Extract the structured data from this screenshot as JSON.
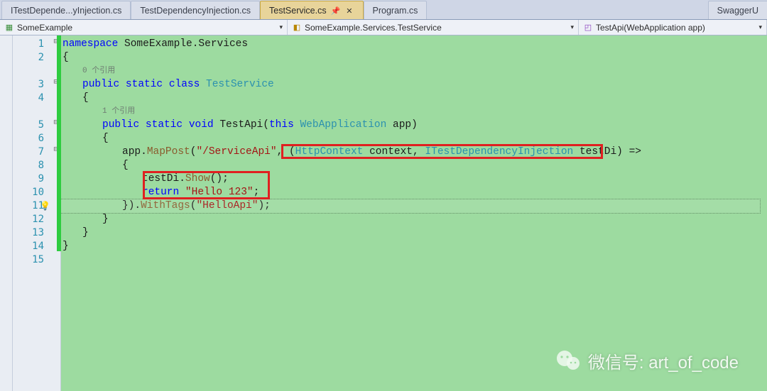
{
  "tabs": [
    {
      "label": "ITestDepende...yInjection.cs",
      "active": false
    },
    {
      "label": "TestDependencyInjection.cs",
      "active": false
    },
    {
      "label": "TestService.cs",
      "active": true,
      "pinned": true
    },
    {
      "label": "Program.cs",
      "active": false
    }
  ],
  "tab_right": {
    "label": "SwaggerU"
  },
  "nav": {
    "project": "SomeExample",
    "type": "SomeExample.Services.TestService",
    "member": "TestApi(WebApplication app)"
  },
  "code": {
    "lines": [
      {
        "n": 1,
        "kind": "code",
        "indent": 0,
        "frag": [
          {
            "t": "namespace ",
            "c": "kw"
          },
          {
            "t": "SomeExample.Services",
            "c": "pun"
          }
        ]
      },
      {
        "n": 2,
        "kind": "code",
        "indent": 0,
        "frag": [
          {
            "t": "{",
            "c": "pun"
          }
        ]
      },
      {
        "n": null,
        "kind": "ref",
        "indent": 1,
        "text": "0 个引用"
      },
      {
        "n": 3,
        "kind": "code",
        "indent": 1,
        "frag": [
          {
            "t": "public static class ",
            "c": "kw"
          },
          {
            "t": "TestService",
            "c": "type"
          }
        ]
      },
      {
        "n": 4,
        "kind": "code",
        "indent": 1,
        "frag": [
          {
            "t": "{",
            "c": "pun"
          }
        ]
      },
      {
        "n": null,
        "kind": "ref",
        "indent": 2,
        "text": "1 个引用"
      },
      {
        "n": 5,
        "kind": "code",
        "indent": 2,
        "frag": [
          {
            "t": "public static ",
            "c": "kw"
          },
          {
            "t": "void ",
            "c": "kw"
          },
          {
            "t": "TestApi(",
            "c": "pun"
          },
          {
            "t": "this ",
            "c": "kw"
          },
          {
            "t": "WebApplication ",
            "c": "type"
          },
          {
            "t": "app)",
            "c": "pun"
          }
        ]
      },
      {
        "n": 6,
        "kind": "code",
        "indent": 2,
        "frag": [
          {
            "t": "{",
            "c": "pun"
          }
        ]
      },
      {
        "n": 7,
        "kind": "code",
        "indent": 3,
        "frag": [
          {
            "t": "app.",
            "c": "pun"
          },
          {
            "t": "MapPost",
            "c": "mtd"
          },
          {
            "t": "(",
            "c": "pun"
          },
          {
            "t": "\"/ServiceApi\"",
            "c": "str"
          },
          {
            "t": ", (",
            "c": "pun"
          },
          {
            "t": "HttpContext ",
            "c": "type"
          },
          {
            "t": "context, ",
            "c": "pun"
          },
          {
            "t": "ITestDependencyInjection ",
            "c": "iface"
          },
          {
            "t": "testDi) =>",
            "c": "pun"
          }
        ]
      },
      {
        "n": 8,
        "kind": "code",
        "indent": 3,
        "frag": [
          {
            "t": "{",
            "c": "pun"
          }
        ]
      },
      {
        "n": 9,
        "kind": "code",
        "indent": 4,
        "frag": [
          {
            "t": "testDi.",
            "c": "pun"
          },
          {
            "t": "Show",
            "c": "mtd"
          },
          {
            "t": "();",
            "c": "pun"
          }
        ]
      },
      {
        "n": 10,
        "kind": "code",
        "indent": 4,
        "frag": [
          {
            "t": "return ",
            "c": "kw"
          },
          {
            "t": "\"Hello 123\"",
            "c": "str"
          },
          {
            "t": ";",
            "c": "pun"
          }
        ]
      },
      {
        "n": 11,
        "kind": "code",
        "indent": 3,
        "frag": [
          {
            "t": "}).",
            "c": "pun"
          },
          {
            "t": "WithTags",
            "c": "mtd"
          },
          {
            "t": "(",
            "c": "pun"
          },
          {
            "t": "\"HelloApi\"",
            "c": "str"
          },
          {
            "t": ");",
            "c": "pun"
          }
        ],
        "caret": true,
        "bulb": true
      },
      {
        "n": 12,
        "kind": "code",
        "indent": 2,
        "frag": [
          {
            "t": "}",
            "c": "pun"
          }
        ]
      },
      {
        "n": 13,
        "kind": "code",
        "indent": 1,
        "frag": [
          {
            "t": "}",
            "c": "pun"
          }
        ]
      },
      {
        "n": 14,
        "kind": "code",
        "indent": 0,
        "frag": [
          {
            "t": "}",
            "c": "pun"
          }
        ]
      },
      {
        "n": 15,
        "kind": "code",
        "indent": 0,
        "frag": []
      }
    ],
    "outline_boxes": [
      {
        "top_row": 8,
        "left_ch": 38,
        "width_ch": 56,
        "rows": 1
      },
      {
        "top_row": 10,
        "left_ch": 14,
        "width_ch": 22,
        "rows": 2
      }
    ]
  },
  "watermark": {
    "label": "微信号: art_of_code"
  }
}
